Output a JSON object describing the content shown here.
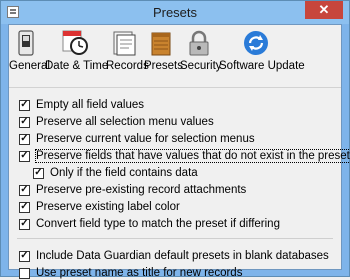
{
  "window": {
    "title": "Presets",
    "close_glyph": "✕"
  },
  "toolbar": {
    "items": [
      {
        "label": "General",
        "icon": "switch-icon"
      },
      {
        "label": "Date & Time",
        "icon": "clock-icon"
      },
      {
        "label": "Records",
        "icon": "records-icon"
      },
      {
        "label": "Presets",
        "icon": "presets-icon"
      },
      {
        "label": "Security",
        "icon": "lock-icon"
      },
      {
        "label": "Software Update",
        "icon": "update-icon"
      }
    ]
  },
  "options": [
    {
      "label": "Empty all field values",
      "checked": true
    },
    {
      "label": "Preserve all selection menu values",
      "checked": true
    },
    {
      "label": "Preserve current value for selection menus",
      "checked": true
    },
    {
      "label": "Preserve fields that have values that do not exist in the preset",
      "checked": true
    },
    {
      "label": "Only if the field contains data",
      "checked": true
    },
    {
      "label": "Preserve pre-existing record attachments",
      "checked": true
    },
    {
      "label": "Preserve existing label color",
      "checked": true
    },
    {
      "label": "Convert field type to match the preset if differing",
      "checked": true
    },
    {
      "label": "Include Data Guardian default presets in blank databases",
      "checked": true
    },
    {
      "label": "Use preset name as title for new records",
      "checked": false
    }
  ],
  "colors": {
    "titlebar": "#8cc0ef",
    "close": "#c7463c",
    "window_bg": "#f0f0f0"
  }
}
